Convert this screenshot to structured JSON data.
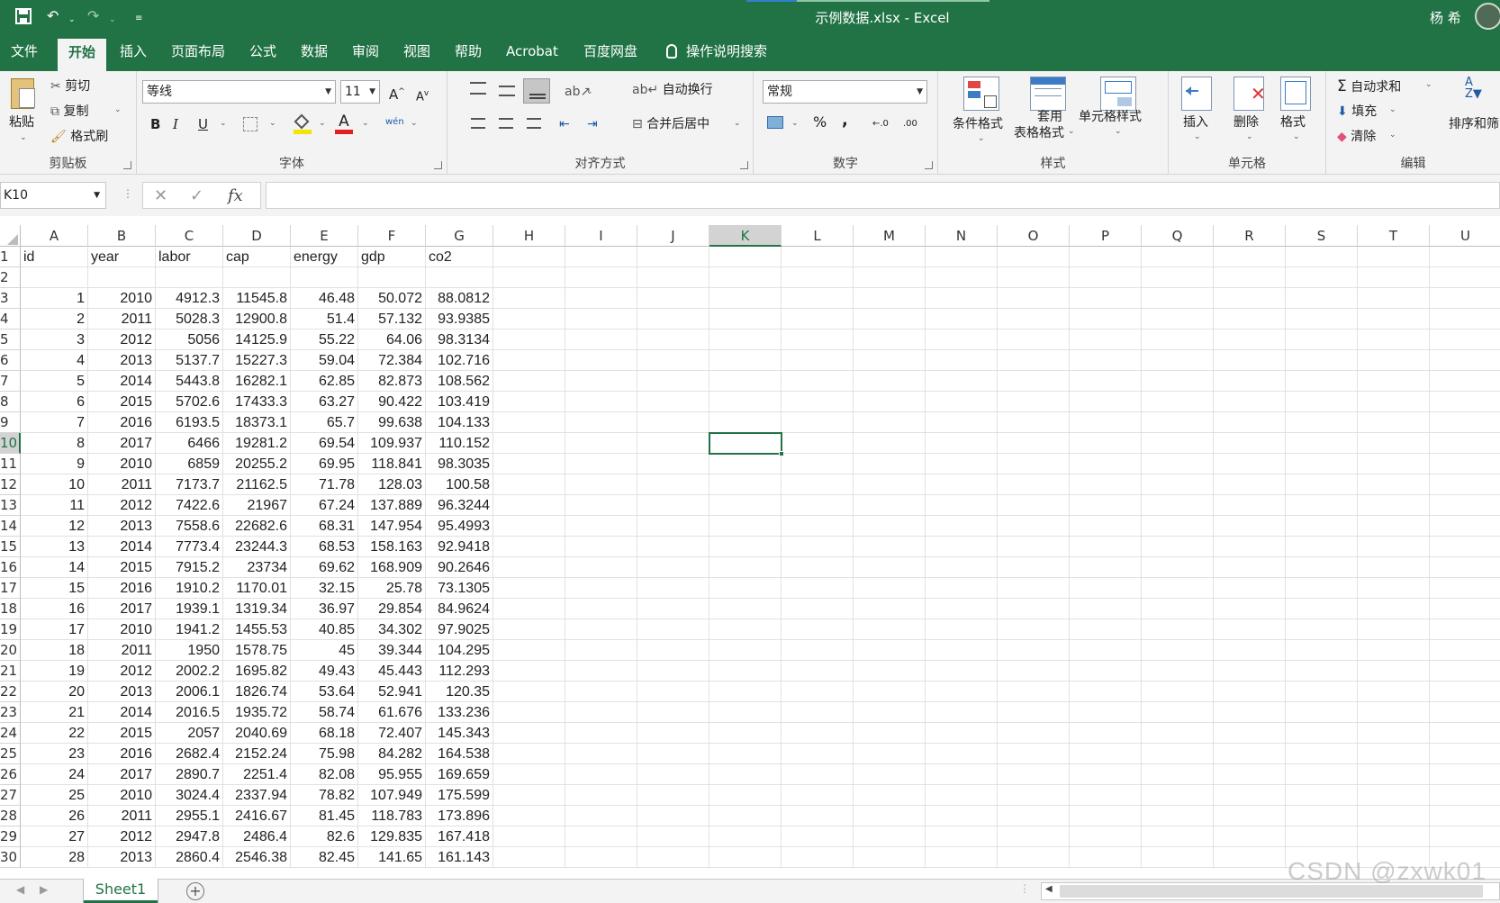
{
  "window": {
    "title": "示例数据.xlsx  -  Excel",
    "user": "杨 希"
  },
  "tabs": [
    "文件",
    "开始",
    "插入",
    "页面布局",
    "公式",
    "数据",
    "审阅",
    "视图",
    "帮助",
    "Acrobat",
    "百度网盘",
    "操作说明搜索"
  ],
  "ribbon": {
    "clipboard": {
      "paste": "粘贴",
      "cut": "剪切",
      "copy": "复制",
      "format_painter": "格式刷",
      "label": "剪贴板"
    },
    "font": {
      "name": "等线",
      "size": "11",
      "grow": "A",
      "shrink": "A",
      "bold": "B",
      "italic": "I",
      "underline": "U",
      "phonetic": "wén",
      "label": "字体"
    },
    "alignment": {
      "wrap": "自动换行",
      "merge": "合并后居中",
      "label": "对齐方式"
    },
    "number": {
      "format": "常规",
      "percent": "%",
      "comma": ",",
      "inc": "←.0",
      "dec": ".00",
      "label": "数字"
    },
    "styles": {
      "conditional": "条件格式",
      "table1": "套用",
      "table2": "表格格式",
      "cell": "单元格样式",
      "label": "样式"
    },
    "cells": {
      "insert": "插入",
      "delete": "删除",
      "format": "格式",
      "label": "单元格"
    },
    "editing": {
      "autosum": "自动求和",
      "fill": "填充",
      "clear": "清除",
      "sort": "排序和筛",
      "label": "编辑"
    }
  },
  "formula_bar": {
    "name_box": "K10",
    "cancel": "✕",
    "enter": "✓",
    "fx": "fx",
    "value": ""
  },
  "columns": [
    "A",
    "B",
    "C",
    "D",
    "E",
    "F",
    "G",
    "H",
    "I",
    "J",
    "K",
    "L",
    "M",
    "N",
    "O",
    "P",
    "Q",
    "R",
    "S",
    "T",
    "U"
  ],
  "selected": {
    "col": "K",
    "row": "10"
  },
  "rows": [
    {
      "n": "1",
      "c": [
        "id",
        "year",
        "labor",
        "cap",
        "energy",
        "gdp",
        "co2"
      ]
    },
    {
      "n": "2",
      "c": [
        "",
        "",
        "",
        "",
        "",
        "",
        ""
      ]
    },
    {
      "n": "3",
      "c": [
        "1",
        "2010",
        "4912.3",
        "11545.8",
        "46.48",
        "50.072",
        "88.0812"
      ]
    },
    {
      "n": "4",
      "c": [
        "2",
        "2011",
        "5028.3",
        "12900.8",
        "51.4",
        "57.132",
        "93.9385"
      ]
    },
    {
      "n": "5",
      "c": [
        "3",
        "2012",
        "5056",
        "14125.9",
        "55.22",
        "64.06",
        "98.3134"
      ]
    },
    {
      "n": "6",
      "c": [
        "4",
        "2013",
        "5137.7",
        "15227.3",
        "59.04",
        "72.384",
        "102.716"
      ]
    },
    {
      "n": "7",
      "c": [
        "5",
        "2014",
        "5443.8",
        "16282.1",
        "62.85",
        "82.873",
        "108.562"
      ]
    },
    {
      "n": "8",
      "c": [
        "6",
        "2015",
        "5702.6",
        "17433.3",
        "63.27",
        "90.422",
        "103.419"
      ]
    },
    {
      "n": "9",
      "c": [
        "7",
        "2016",
        "6193.5",
        "18373.1",
        "65.7",
        "99.638",
        "104.133"
      ]
    },
    {
      "n": "10",
      "c": [
        "8",
        "2017",
        "6466",
        "19281.2",
        "69.54",
        "109.937",
        "110.152"
      ]
    },
    {
      "n": "11",
      "c": [
        "9",
        "2010",
        "6859",
        "20255.2",
        "69.95",
        "118.841",
        "98.3035"
      ]
    },
    {
      "n": "12",
      "c": [
        "10",
        "2011",
        "7173.7",
        "21162.5",
        "71.78",
        "128.03",
        "100.58"
      ]
    },
    {
      "n": "13",
      "c": [
        "11",
        "2012",
        "7422.6",
        "21967",
        "67.24",
        "137.889",
        "96.3244"
      ]
    },
    {
      "n": "14",
      "c": [
        "12",
        "2013",
        "7558.6",
        "22682.6",
        "68.31",
        "147.954",
        "95.4993"
      ]
    },
    {
      "n": "15",
      "c": [
        "13",
        "2014",
        "7773.4",
        "23244.3",
        "68.53",
        "158.163",
        "92.9418"
      ]
    },
    {
      "n": "16",
      "c": [
        "14",
        "2015",
        "7915.2",
        "23734",
        "69.62",
        "168.909",
        "90.2646"
      ]
    },
    {
      "n": "17",
      "c": [
        "15",
        "2016",
        "1910.2",
        "1170.01",
        "32.15",
        "25.78",
        "73.1305"
      ]
    },
    {
      "n": "18",
      "c": [
        "16",
        "2017",
        "1939.1",
        "1319.34",
        "36.97",
        "29.854",
        "84.9624"
      ]
    },
    {
      "n": "19",
      "c": [
        "17",
        "2010",
        "1941.2",
        "1455.53",
        "40.85",
        "34.302",
        "97.9025"
      ]
    },
    {
      "n": "20",
      "c": [
        "18",
        "2011",
        "1950",
        "1578.75",
        "45",
        "39.344",
        "104.295"
      ]
    },
    {
      "n": "21",
      "c": [
        "19",
        "2012",
        "2002.2",
        "1695.82",
        "49.43",
        "45.443",
        "112.293"
      ]
    },
    {
      "n": "22",
      "c": [
        "20",
        "2013",
        "2006.1",
        "1826.74",
        "53.64",
        "52.941",
        "120.35"
      ]
    },
    {
      "n": "23",
      "c": [
        "21",
        "2014",
        "2016.5",
        "1935.72",
        "58.74",
        "61.676",
        "133.236"
      ]
    },
    {
      "n": "24",
      "c": [
        "22",
        "2015",
        "2057",
        "2040.69",
        "68.18",
        "72.407",
        "145.343"
      ]
    },
    {
      "n": "25",
      "c": [
        "23",
        "2016",
        "2682.4",
        "2152.24",
        "75.98",
        "84.282",
        "164.538"
      ]
    },
    {
      "n": "26",
      "c": [
        "24",
        "2017",
        "2890.7",
        "2251.4",
        "82.08",
        "95.955",
        "169.659"
      ]
    },
    {
      "n": "27",
      "c": [
        "25",
        "2010",
        "3024.4",
        "2337.94",
        "78.82",
        "107.949",
        "175.599"
      ]
    },
    {
      "n": "28",
      "c": [
        "26",
        "2011",
        "2955.1",
        "2416.67",
        "81.45",
        "118.783",
        "173.896"
      ]
    },
    {
      "n": "29",
      "c": [
        "27",
        "2012",
        "2947.8",
        "2486.4",
        "82.6",
        "129.835",
        "167.418"
      ]
    },
    {
      "n": "30",
      "c": [
        "28",
        "2013",
        "2860.4",
        "2546.38",
        "82.45",
        "141.65",
        "161.143"
      ]
    }
  ],
  "sheet_tab": "Sheet1",
  "watermark": "CSDN @zxwk01",
  "colors": {
    "brand": "#217346",
    "ribbon_bg": "#f3f3f3"
  }
}
